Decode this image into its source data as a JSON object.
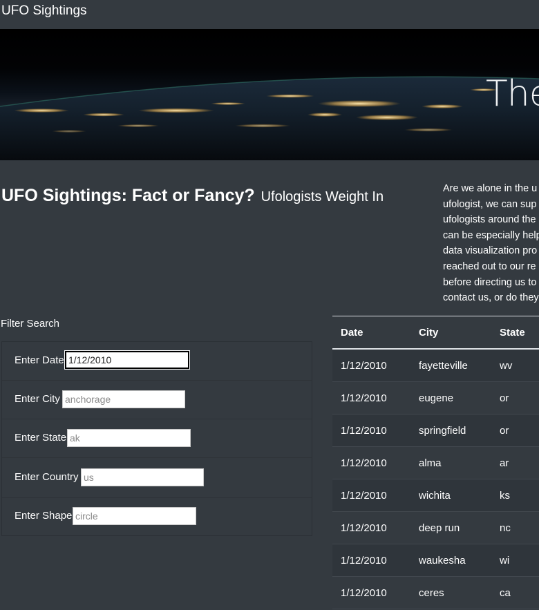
{
  "navbar": {
    "brand": "UFO Sightings"
  },
  "hero": {
    "title": "The"
  },
  "headline": {
    "main": "UFO Sightings: Fact or Fancy?",
    "sub": "Ufologists Weight In"
  },
  "intro": {
    "lines": [
      "Are we alone in the u",
      "ufologist, we can sup",
      "ufologists around the",
      "can be especially help",
      "data visualization pro",
      "reached out to our re",
      "before directing us to",
      "contact us, or do they"
    ]
  },
  "filters": {
    "title": "Filter Search",
    "fields": [
      {
        "label": "Enter Date",
        "value": "1/12/2010",
        "placeholder": ""
      },
      {
        "label": "Enter City",
        "value": "",
        "placeholder": "anchorage"
      },
      {
        "label": "Enter State",
        "value": "",
        "placeholder": "ak"
      },
      {
        "label": "Enter Country",
        "value": "",
        "placeholder": "us"
      },
      {
        "label": "Enter Shape",
        "value": "",
        "placeholder": "circle"
      }
    ]
  },
  "table": {
    "headers": [
      "Date",
      "City",
      "State"
    ],
    "rows": [
      [
        "1/12/2010",
        "fayetteville",
        "wv"
      ],
      [
        "1/12/2010",
        "eugene",
        "or"
      ],
      [
        "1/12/2010",
        "springfield",
        "or"
      ],
      [
        "1/12/2010",
        "alma",
        "ar"
      ],
      [
        "1/12/2010",
        "wichita",
        "ks"
      ],
      [
        "1/12/2010",
        "deep run",
        "nc"
      ],
      [
        "1/12/2010",
        "waukesha",
        "wi"
      ],
      [
        "1/12/2010",
        "ceres",
        "ca"
      ]
    ]
  },
  "colors": {
    "background": "#343a40",
    "text": "#ffffff",
    "table_border": "#dee2e6",
    "row_stripe": "#2f353b"
  }
}
